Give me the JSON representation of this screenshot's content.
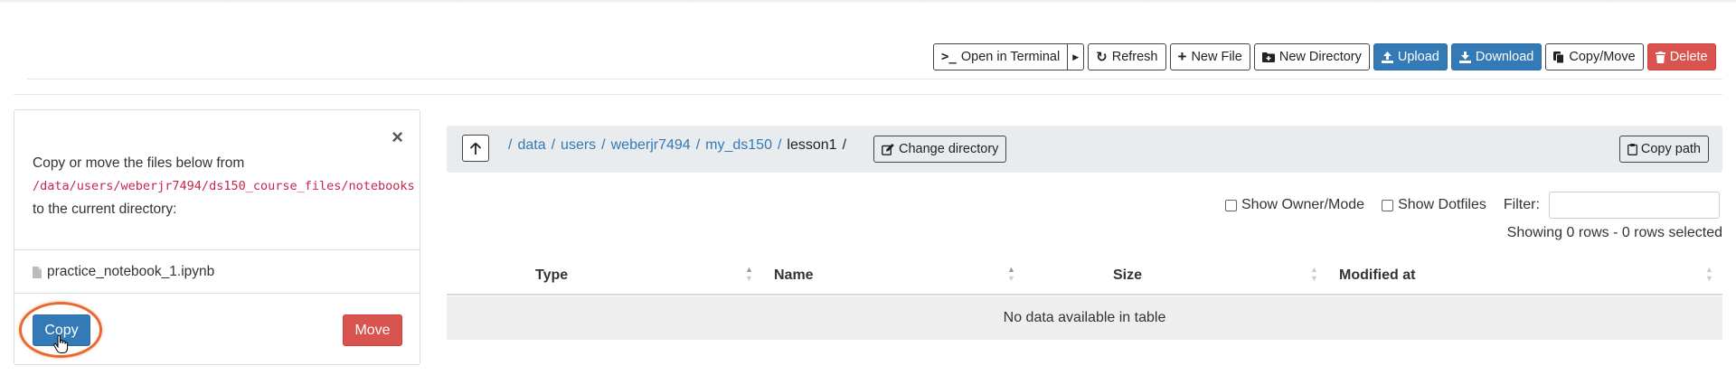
{
  "toolbar": {
    "open_terminal": "Open in Terminal",
    "refresh": "Refresh",
    "new_file": "New File",
    "new_directory": "New Directory",
    "upload": "Upload",
    "download": "Download",
    "copy_move": "Copy/Move",
    "delete": "Delete"
  },
  "copy_panel": {
    "message_prefix": "Copy or move the files below from ",
    "source_path": "/data/users/weberjr7494/ds150_course_files/notebooks",
    "message_suffix": " to the current directory:",
    "files": [
      "practice_notebook_1.ipynb"
    ],
    "copy_label": "Copy",
    "move_label": "Move"
  },
  "breadcrumb": {
    "items": [
      "data",
      "users",
      "weberjr7494",
      "my_ds150"
    ],
    "current": "lesson1",
    "change_directory": "Change directory",
    "copy_path": "Copy path"
  },
  "options": {
    "show_owner_mode": "Show Owner/Mode",
    "show_dotfiles": "Show Dotfiles",
    "filter_label": "Filter:",
    "filter_value": ""
  },
  "table": {
    "info": "Showing 0 rows - 0 rows selected",
    "columns": [
      "Type",
      "Name",
      "Size",
      "Modified at"
    ],
    "empty_message": "No data available in table"
  },
  "colors": {
    "primary": "#337ab7",
    "danger": "#d9534f",
    "link": "#337ab7",
    "highlight_ring": "#e8692f",
    "code": "#c7254e"
  }
}
